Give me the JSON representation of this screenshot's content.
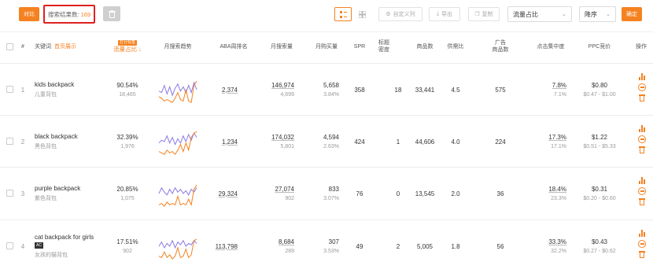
{
  "toolbar": {
    "compare_label": "对比",
    "search_count_label": "搜索结果数:",
    "search_count_value": "169",
    "custom_columns_label": "自定义列",
    "export_label": "导出",
    "copy_label": "复制",
    "sort_field": "流量占比",
    "sort_order": "降序",
    "confirm_label": "确定"
  },
  "table": {
    "headers": {
      "index": "#",
      "keyword": "关键词",
      "keyword_sub": "首页展示",
      "traffic_badge": "打分标签",
      "traffic": "流量占比",
      "trend": "月搜索趋势",
      "aba": "ABA周排名",
      "monthly_search": "月搜索量",
      "monthly_purchase": "月购买量",
      "spr": "SPR",
      "title_density": "标题\n密度",
      "product_count": "商品数",
      "supply_ratio": "供需比",
      "ad_products": "广告\n商品数",
      "click_concentration": "点击集中度",
      "ppc": "PPC竞价",
      "actions": "操作"
    },
    "rows": [
      {
        "index": "1",
        "keyword": "kids backpack",
        "keyword_cn": "儿童背包",
        "badge": "",
        "traffic_pct": "90.54%",
        "traffic_count": "18,465",
        "aba": "2,374",
        "monthly_search": "146,974",
        "monthly_search_sub": "4,699",
        "monthly_purchase": "5,658",
        "monthly_purchase_pct": "3.84%",
        "spr": "358",
        "title_density": "18",
        "product_count": "33,441",
        "supply_ratio": "4.5",
        "ad_products": "575",
        "click_concentration": "7.8%",
        "click_concentration_sub": "7.1%",
        "ppc": "$0.80",
        "ppc_range": "$0.47 - $1.00",
        "trend_purple": [
          0.55,
          0.6,
          0.35,
          0.65,
          0.4,
          0.7,
          0.45,
          0.3,
          0.55,
          0.4,
          0.6,
          0.35,
          0.6,
          0.25,
          0.5
        ],
        "trend_orange": [
          0.75,
          0.8,
          0.9,
          0.85,
          0.9,
          0.95,
          0.8,
          0.6,
          0.85,
          0.9,
          0.5,
          0.9,
          0.95,
          0.35,
          0.2
        ]
      },
      {
        "index": "2",
        "keyword": "black backpack",
        "keyword_cn": "黑色背包",
        "badge": "",
        "traffic_pct": "32.39%",
        "traffic_count": "1,976",
        "aba": "1,234",
        "monthly_search": "174,032",
        "monthly_search_sub": "5,801",
        "monthly_purchase": "4,594",
        "monthly_purchase_pct": "2.63%",
        "spr": "424",
        "title_density": "1",
        "product_count": "44,606",
        "supply_ratio": "4.0",
        "ad_products": "224",
        "click_concentration": "17.3%",
        "click_concentration_sub": "17.1%",
        "ppc": "$1.22",
        "ppc_range": "$0.51 - $5.33",
        "trend_purple": [
          0.55,
          0.45,
          0.5,
          0.3,
          0.55,
          0.35,
          0.6,
          0.4,
          0.55,
          0.3,
          0.5,
          0.25,
          0.45,
          0.2,
          0.35
        ],
        "trend_orange": [
          0.85,
          0.9,
          0.95,
          0.8,
          0.9,
          0.85,
          0.95,
          0.8,
          0.6,
          0.85,
          0.55,
          0.8,
          0.35,
          0.2,
          0.15
        ]
      },
      {
        "index": "3",
        "keyword": "purple backpack",
        "keyword_cn": "紫色背包",
        "badge": "",
        "traffic_pct": "20.85%",
        "traffic_count": "1,075",
        "aba": "29,324",
        "monthly_search": "27,074",
        "monthly_search_sub": "902",
        "monthly_purchase": "833",
        "monthly_purchase_pct": "3.07%",
        "spr": "76",
        "title_density": "0",
        "product_count": "13,545",
        "supply_ratio": "2.0",
        "ad_products": "36",
        "click_concentration": "18.4%",
        "click_concentration_sub": "23.3%",
        "ppc": "$0.31",
        "ppc_range": "$0.20 - $0.60",
        "trend_purple": [
          0.5,
          0.3,
          0.45,
          0.55,
          0.35,
          0.5,
          0.3,
          0.45,
          0.35,
          0.5,
          0.4,
          0.55,
          0.35,
          0.45,
          0.3
        ],
        "trend_orange": [
          0.9,
          0.85,
          0.95,
          0.8,
          0.9,
          0.85,
          0.9,
          0.6,
          0.9,
          0.85,
          0.9,
          0.7,
          0.9,
          0.35,
          0.2
        ]
      },
      {
        "index": "4",
        "keyword": "cat backpack for girls",
        "keyword_cn": "女孩的猫背包",
        "badge": "AC",
        "traffic_pct": "17.51%",
        "traffic_count": "902",
        "aba": "113,798",
        "monthly_search": "8,684",
        "monthly_search_sub": "289",
        "monthly_purchase": "307",
        "monthly_purchase_pct": "3.53%",
        "spr": "49",
        "title_density": "2",
        "product_count": "5,005",
        "supply_ratio": "1.8",
        "ad_products": "56",
        "click_concentration": "33.3%",
        "click_concentration_sub": "32.2%",
        "ppc": "$0.43",
        "ppc_range": "$0.27 - $0.62",
        "trend_purple": [
          0.5,
          0.35,
          0.55,
          0.4,
          0.5,
          0.3,
          0.55,
          0.35,
          0.45,
          0.3,
          0.5,
          0.4,
          0.45,
          0.3,
          0.4
        ],
        "trend_orange": [
          0.85,
          0.9,
          0.7,
          0.9,
          0.8,
          0.95,
          0.85,
          0.55,
          0.9,
          0.85,
          0.6,
          0.9,
          0.8,
          0.3,
          0.25
        ]
      }
    ]
  },
  "colors": {
    "accent": "#f58220",
    "trend_purple": "#8c7ae6",
    "trend_orange": "#f58220",
    "highlight_border": "#e02020"
  },
  "icons": [
    "grid-view-icon",
    "list-view-icon",
    "gear-icon",
    "download-icon",
    "copy-icon",
    "chevron-down-icon",
    "bar-chart-icon",
    "minus-circle-icon",
    "trash-icon",
    "delete-icon"
  ]
}
